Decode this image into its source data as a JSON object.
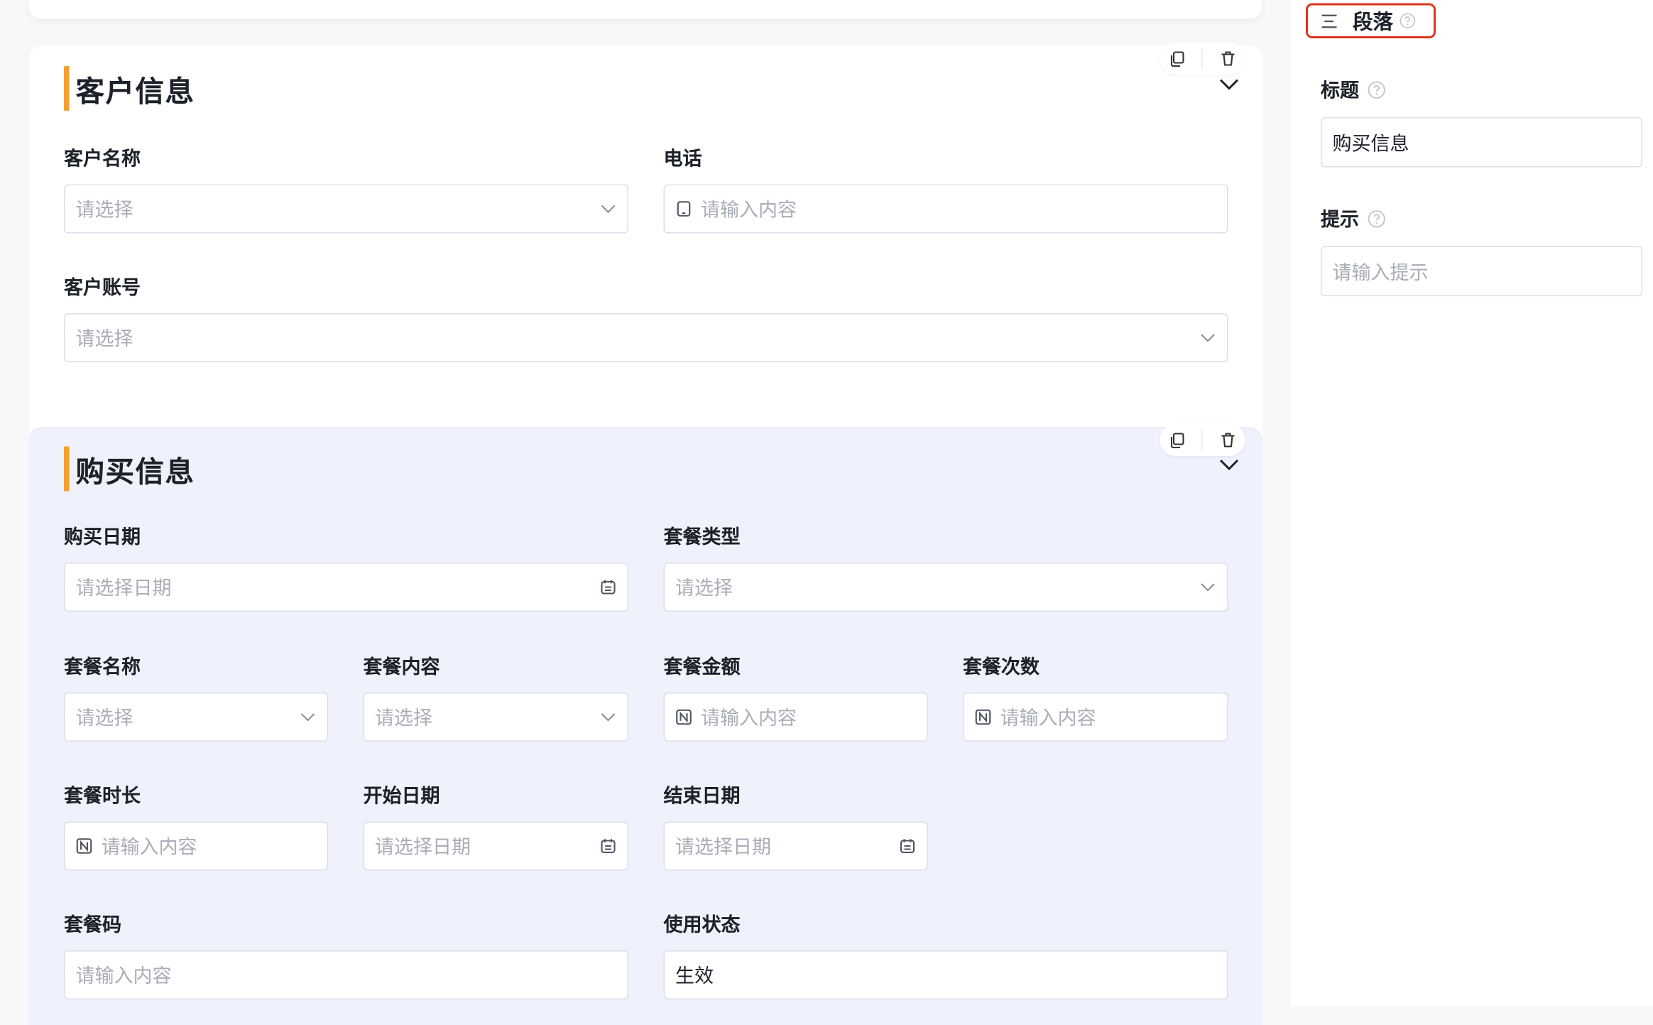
{
  "customer_section": {
    "title": "客户信息",
    "fields": {
      "customer_name": {
        "label": "客户名称",
        "placeholder": "请选择"
      },
      "phone": {
        "label": "电话",
        "placeholder": "请输入内容"
      },
      "customer_account": {
        "label": "客户账号",
        "placeholder": "请选择"
      }
    }
  },
  "purchase_section": {
    "title": "购买信息",
    "fields": {
      "purchase_date": {
        "label": "购买日期",
        "placeholder": "请选择日期"
      },
      "package_type": {
        "label": "套餐类型",
        "placeholder": "请选择"
      },
      "package_name": {
        "label": "套餐名称",
        "placeholder": "请选择"
      },
      "package_content": {
        "label": "套餐内容",
        "placeholder": "请选择"
      },
      "package_amount": {
        "label": "套餐金额",
        "placeholder": "请输入内容"
      },
      "package_times": {
        "label": "套餐次数",
        "placeholder": "请输入内容"
      },
      "package_duration": {
        "label": "套餐时长",
        "placeholder": "请输入内容"
      },
      "start_date": {
        "label": "开始日期",
        "placeholder": "请选择日期"
      },
      "end_date": {
        "label": "结束日期",
        "placeholder": "请选择日期"
      },
      "package_code": {
        "label": "套餐码",
        "placeholder": "请输入内容"
      },
      "usage_status": {
        "label": "使用状态",
        "value": "生效"
      }
    }
  },
  "right_panel": {
    "tab_label": "段落",
    "title_label": "标题",
    "title_value": "购买信息",
    "hint_label": "提示",
    "hint_placeholder": "请输入提示"
  },
  "icons": [
    "copy-icon",
    "trash-icon",
    "chevron-down-icon",
    "calendar-icon",
    "phone-icon",
    "number-icon",
    "help-icon",
    "paragraph-icon"
  ],
  "colors": {
    "accent_bar": "#f5a030",
    "highlight_border": "#d9361e",
    "purchase_bg": "#eff2fc"
  }
}
